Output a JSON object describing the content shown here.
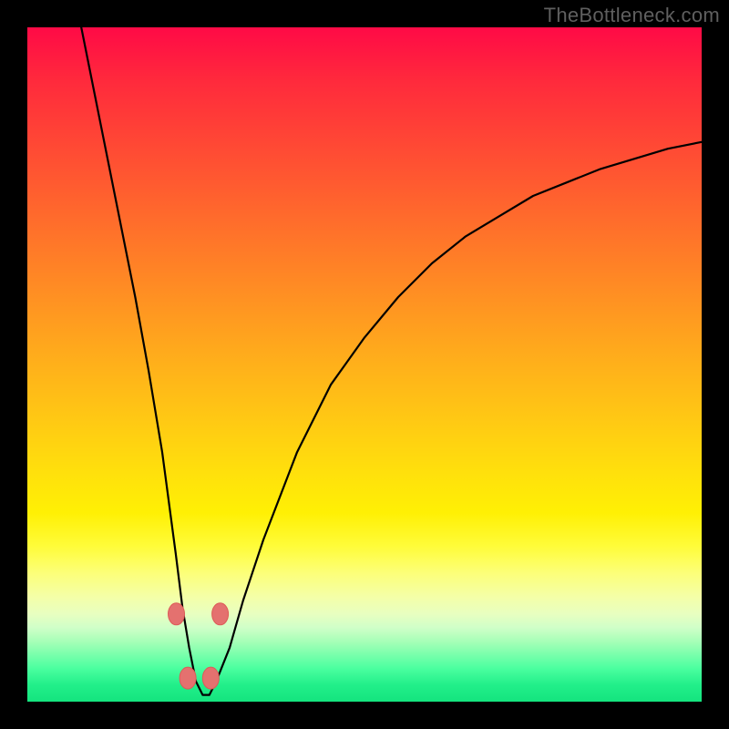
{
  "watermark": "TheBottleneck.com",
  "chart_data": {
    "type": "line",
    "title": "",
    "xlabel": "",
    "ylabel": "",
    "xlim": [
      0,
      100
    ],
    "ylim": [
      0,
      100
    ],
    "grid": false,
    "legend": false,
    "background_gradient": {
      "orientation": "vertical",
      "stops": [
        {
          "pos": 0,
          "color": "#ff0a46",
          "meaning": "worst"
        },
        {
          "pos": 50,
          "color": "#ffaa1c"
        },
        {
          "pos": 75,
          "color": "#fff004"
        },
        {
          "pos": 100,
          "color": "#14e47e",
          "meaning": "best"
        }
      ]
    },
    "series": [
      {
        "name": "bottleneck-curve",
        "x": [
          8,
          10,
          12,
          14,
          16,
          18,
          20,
          22,
          23,
          24,
          25,
          26,
          27,
          28,
          30,
          32,
          35,
          40,
          45,
          50,
          55,
          60,
          65,
          70,
          75,
          80,
          85,
          90,
          95,
          100
        ],
        "y": [
          100,
          90,
          80,
          70,
          60,
          49,
          37,
          22,
          14,
          8,
          3,
          1,
          1,
          3,
          8,
          15,
          24,
          37,
          47,
          54,
          60,
          65,
          69,
          72,
          75,
          77,
          79,
          80.5,
          82,
          83
        ]
      }
    ],
    "markers": [
      {
        "x": 22.1,
        "y": 13.0
      },
      {
        "x": 28.6,
        "y": 13.0
      },
      {
        "x": 23.8,
        "y": 3.5
      },
      {
        "x": 27.2,
        "y": 3.5
      }
    ],
    "annotations": []
  }
}
